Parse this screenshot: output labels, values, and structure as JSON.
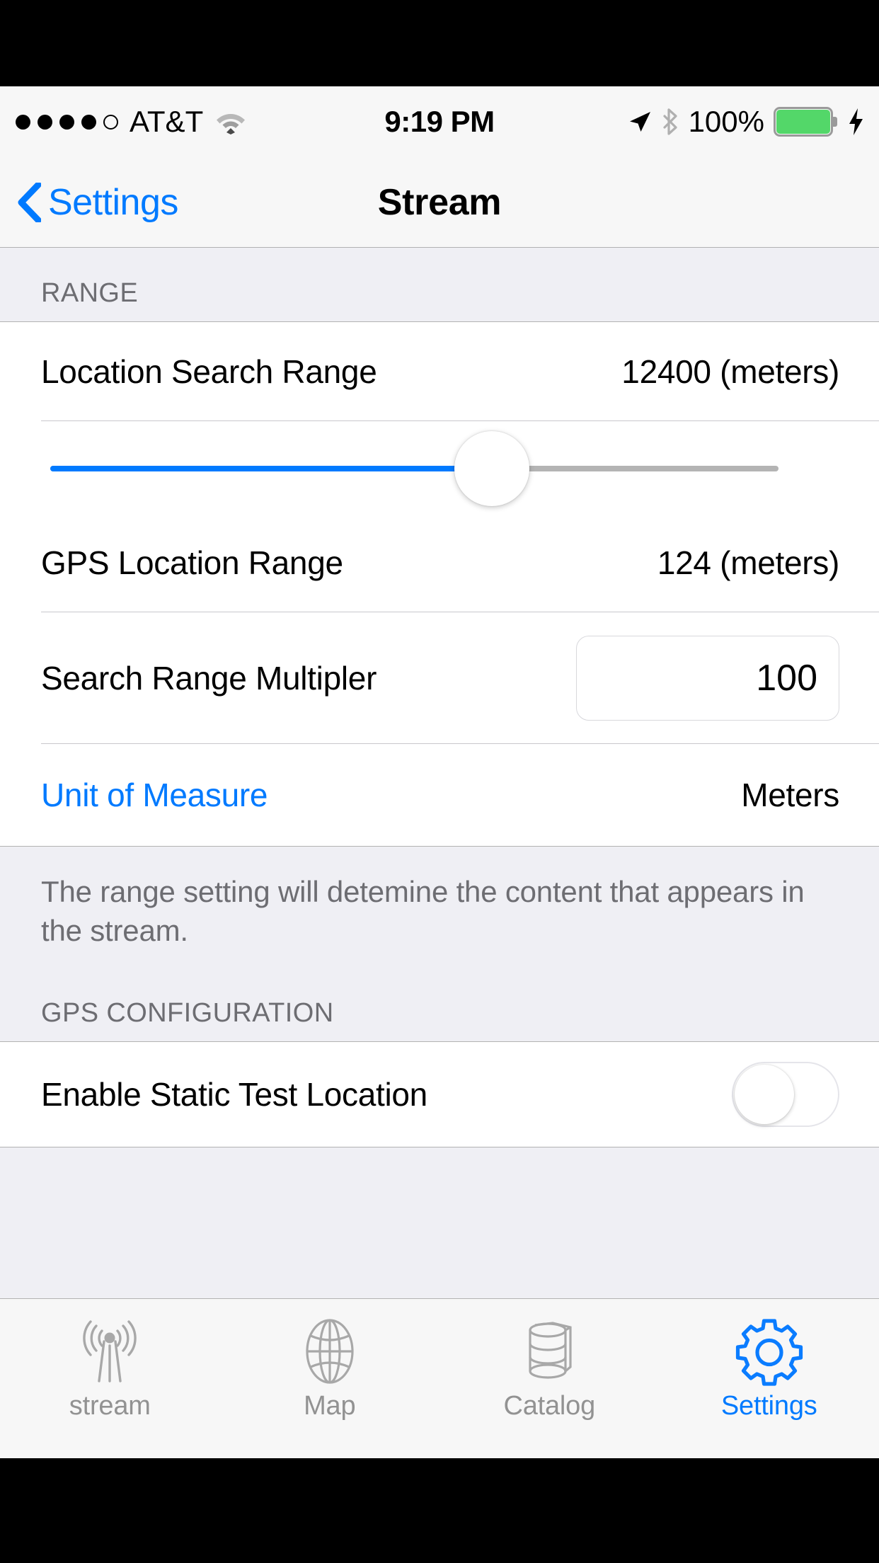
{
  "status_bar": {
    "signal_dots_filled": 4,
    "signal_dots_total": 5,
    "carrier": "AT&T",
    "wifi_icon": "wifi-icon",
    "time": "9:19 PM",
    "location_icon": "location-arrow-icon",
    "bluetooth_icon": "bluetooth-icon",
    "battery_percent": "100%",
    "battery_icon": "battery-full-icon",
    "charging_icon": "lightning-bolt-icon",
    "battery_color": "#53d769"
  },
  "nav_bar": {
    "back_icon": "chevron-left-icon",
    "back_label": "Settings",
    "title": "Stream"
  },
  "sections": [
    {
      "header": "RANGE",
      "rows": [
        {
          "label": "Location Search Range",
          "value": "12400 (meters)"
        },
        {
          "label": "GPS Location Range",
          "value": "124 (meters)"
        },
        {
          "label": "Search Range Multipler",
          "field_value": "100"
        },
        {
          "label": "Unit of Measure",
          "value": "Meters"
        }
      ],
      "footer": "The range setting will detemine the content that appears in the stream."
    },
    {
      "header": "GPS CONFIGURATION",
      "rows": [
        {
          "label": "Enable Static Test Location",
          "toggle_state": "off"
        }
      ]
    }
  ],
  "slider": {
    "fill_percent": 60.6,
    "track_color": "#b4b4b4",
    "fill_color": "#007aff",
    "thumb_color": "#ffffff"
  },
  "tab_bar": {
    "tabs": [
      {
        "label": "stream",
        "icon": "broadcast-tower-icon",
        "active": false
      },
      {
        "label": "Map",
        "icon": "globe-icon",
        "active": false
      },
      {
        "label": "Catalog",
        "icon": "database-stack-icon",
        "active": false
      },
      {
        "label": "Settings",
        "icon": "gear-icon",
        "active": true
      }
    ],
    "active_color": "#007aff",
    "inactive_color": "#929292"
  }
}
